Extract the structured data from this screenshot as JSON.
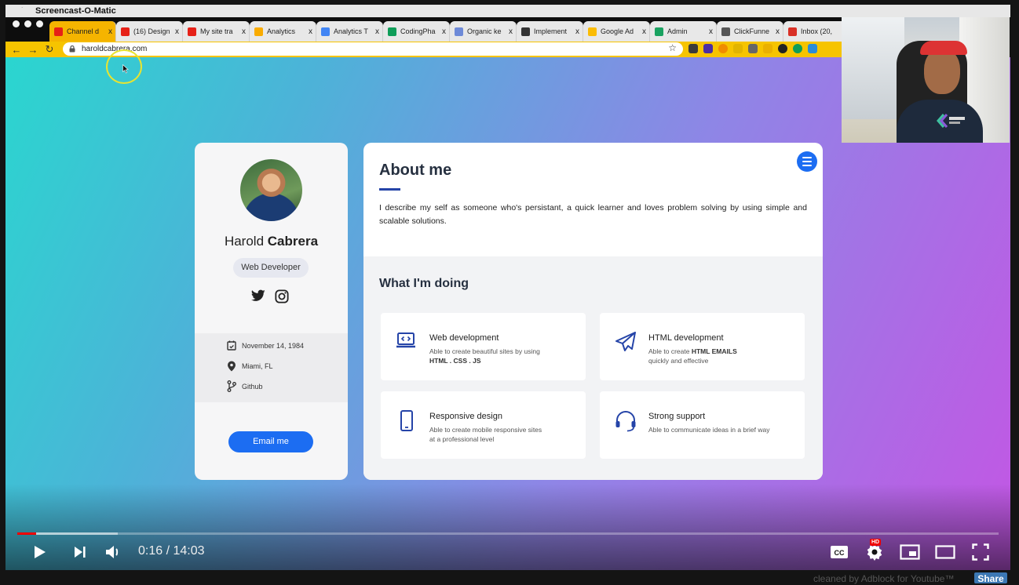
{
  "os": {
    "app_name": "Screencast-O-Matic"
  },
  "browser": {
    "tabs": [
      {
        "title": "Channel d",
        "favicon_color": "#e62117"
      },
      {
        "title": "(16) Design",
        "favicon_color": "#e62117"
      },
      {
        "title": "My site tra",
        "favicon_color": "#e62117"
      },
      {
        "title": "Analytics",
        "favicon_color": "#f9ab00"
      },
      {
        "title": "Analytics T",
        "favicon_color": "#4285f4"
      },
      {
        "title": "CodingPha",
        "favicon_color": "#0f9d58"
      },
      {
        "title": "Organic ke",
        "favicon_color": "#6e8ad8"
      },
      {
        "title": "Implement",
        "favicon_color": "#333333"
      },
      {
        "title": "Google Ad",
        "favicon_color": "#fbbc04"
      },
      {
        "title": "Admin",
        "favicon_color": "#1aa260"
      },
      {
        "title": "ClickFunne",
        "favicon_color": "#555555"
      },
      {
        "title": "Inbox (20,",
        "favicon_color": "#d93025"
      }
    ],
    "tab_close_glyph": "x",
    "url": "haroldcabrera.com"
  },
  "profile": {
    "first_name": "Harold",
    "last_name": "Cabrera",
    "role": "Web Developer",
    "birthday": "November 14, 1984",
    "location": "Miami, FL",
    "github": "Github",
    "email_button": "Email me"
  },
  "about": {
    "title": "About me",
    "description": "I describe my self as someone who's persistant, a quick learner and loves problem solving by using simple and scalable solutions.",
    "doing_title": "What I'm doing",
    "services": [
      {
        "title": "Web development",
        "desc_pre": "Able to create beautiful sites by using",
        "desc_bold": "HTML . CSS . JS",
        "desc_post": ""
      },
      {
        "title": "HTML development",
        "desc_pre": "Able to create",
        "desc_bold": "HTML EMAILS",
        "desc_post": "quickly and effective"
      },
      {
        "title": "Responsive design",
        "desc_pre": "Able to create mobile responsive sites",
        "desc_bold": "",
        "desc_post": "at a professional level"
      },
      {
        "title": "Strong support",
        "desc_pre": "Able to communicate ideas in a brief way",
        "desc_bold": "",
        "desc_post": ""
      }
    ]
  },
  "player": {
    "time_current": "0:16",
    "time_total": "14:03",
    "time_display": "0:16 / 14:03",
    "played_fraction": 0.019,
    "buffered_fraction": 0.102,
    "hd_badge": "HD",
    "cc_label": "CC"
  },
  "footer": {
    "adblock_text": "cleaned by Adblock for Youtube™",
    "share_label": "Share"
  },
  "colors": {
    "accent": "#1c6df2",
    "heading": "#263040",
    "progress": "#e00000"
  }
}
